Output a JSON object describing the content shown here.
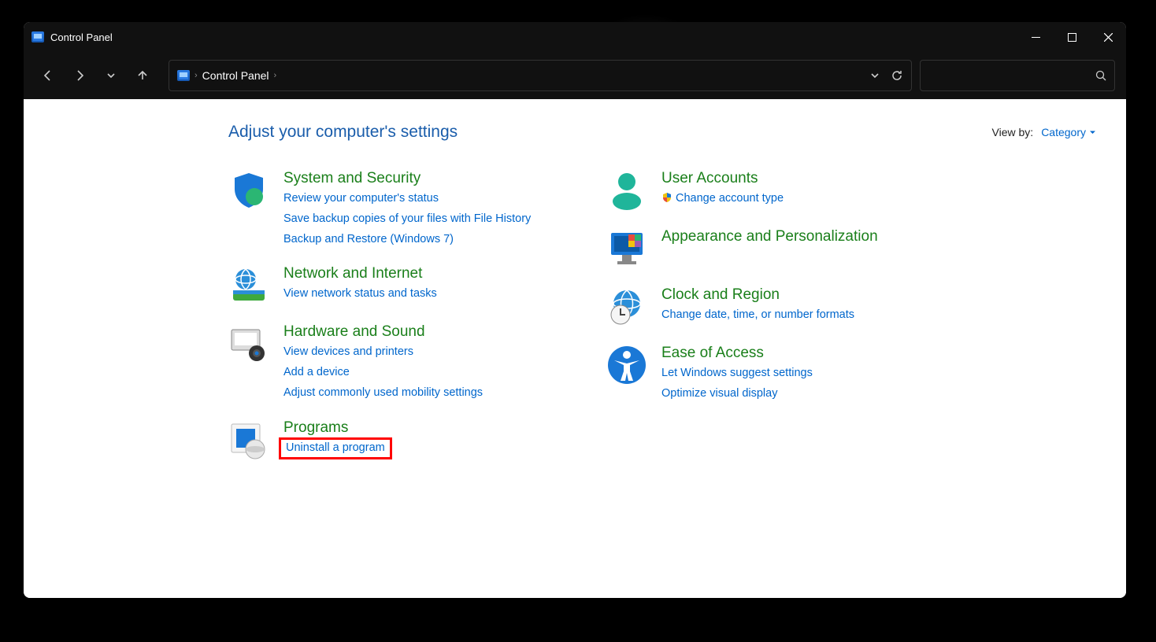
{
  "window": {
    "title": "Control Panel"
  },
  "breadcrumb": {
    "root": "Control Panel"
  },
  "header": {
    "title": "Adjust your computer's settings",
    "viewby_label": "View by:",
    "viewby_value": "Category"
  },
  "left": [
    {
      "id": "system-security",
      "title": "System and Security",
      "links": [
        "Review your computer's status",
        "Save backup copies of your files with File History",
        "Backup and Restore (Windows 7)"
      ]
    },
    {
      "id": "network",
      "title": "Network and Internet",
      "links": [
        "View network status and tasks"
      ]
    },
    {
      "id": "hardware",
      "title": "Hardware and Sound",
      "links": [
        "View devices and printers",
        "Add a device",
        "Adjust commonly used mobility settings"
      ]
    },
    {
      "id": "programs",
      "title": "Programs",
      "links": [
        "Uninstall a program"
      ]
    }
  ],
  "right": [
    {
      "id": "user-accounts",
      "title": "User Accounts",
      "links": [
        "Change account type"
      ],
      "shield_on": [
        0
      ]
    },
    {
      "id": "appearance",
      "title": "Appearance and Personalization",
      "links": []
    },
    {
      "id": "clock",
      "title": "Clock and Region",
      "links": [
        "Change date, time, or number formats"
      ]
    },
    {
      "id": "ease",
      "title": "Ease of Access",
      "links": [
        "Let Windows suggest settings",
        "Optimize visual display"
      ]
    }
  ],
  "highlight": {
    "col": "left",
    "cat": 3,
    "link": 0
  }
}
